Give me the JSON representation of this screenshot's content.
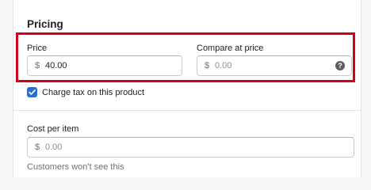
{
  "section": {
    "title": "Pricing"
  },
  "price": {
    "label": "Price",
    "currency": "$",
    "value": "40.00"
  },
  "compare_at_price": {
    "label": "Compare at price",
    "currency": "$",
    "placeholder": "0.00",
    "help_icon": "question-circle-icon"
  },
  "charge_tax": {
    "label": "Charge tax on this product",
    "checked": true
  },
  "cost_per_item": {
    "label": "Cost per item",
    "currency": "$",
    "placeholder": "0.00",
    "help_text": "Customers won't see this"
  },
  "colors": {
    "highlight": "#d0021b",
    "checkbox": "#2c6ecb"
  }
}
